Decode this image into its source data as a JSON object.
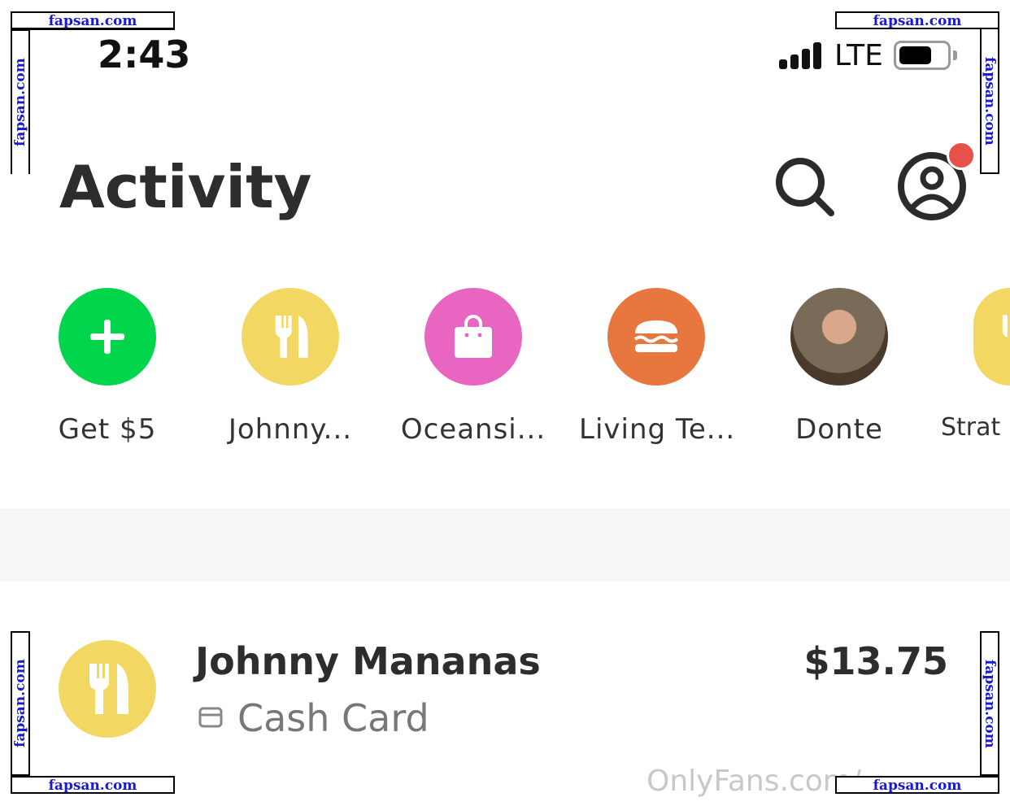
{
  "status_bar": {
    "time": "2:43",
    "network": "LTE",
    "signal_bars": 4,
    "battery_percent": 70
  },
  "header": {
    "title": "Activity"
  },
  "shortcuts": [
    {
      "label": "Get $5",
      "color": "#00d54b",
      "icon": "plus-icon"
    },
    {
      "label": "Johnny...",
      "color": "#f2d862",
      "icon": "fork-knife-icon"
    },
    {
      "label": "Oceansi...",
      "color": "#e866c2",
      "icon": "shopping-bag-icon"
    },
    {
      "label": "Living Te...",
      "color": "#e8763f",
      "icon": "burger-icon"
    },
    {
      "label": "Donte",
      "color": "#8a7460",
      "icon": "avatar-photo"
    },
    {
      "label": "Strat",
      "color": "#f2d862",
      "icon": "fork-knife-icon"
    }
  ],
  "activity": [
    {
      "name": "Johnny Mananas",
      "method": "Cash Card",
      "amount": "$13.75",
      "color": "#f2d862"
    }
  ],
  "watermarks": {
    "site": "fapsan.com",
    "onlyfans": "OnlyFans.com/"
  }
}
